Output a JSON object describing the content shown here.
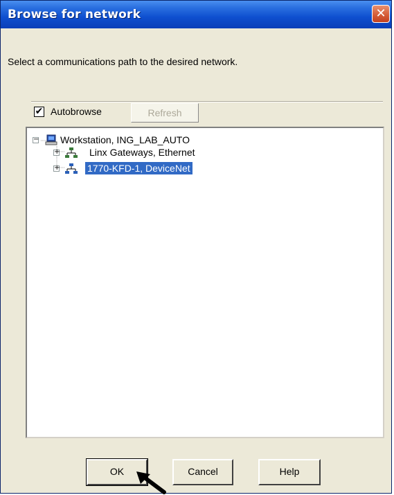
{
  "window": {
    "title": "Browse for network"
  },
  "instruction": "Select a communications path to the desired network.",
  "autobrowse": {
    "label": "Autobrowse",
    "checked": true,
    "check_glyph": "✔"
  },
  "refresh_button": {
    "label": "Refresh",
    "enabled": false
  },
  "tree": {
    "root": {
      "label": "Workstation, ING_LAB_AUTO",
      "icon": "workstation-icon",
      "expander": "−"
    },
    "children": [
      {
        "label": "Linx Gateways, Ethernet",
        "icon": "network-icon",
        "expander": "+"
      },
      {
        "label": "1770-KFD-1, DeviceNet",
        "icon": "network-icon",
        "expander": "+",
        "selected": true
      }
    ]
  },
  "buttons": {
    "ok": "OK",
    "cancel": "Cancel",
    "help": "Help"
  },
  "close_glyph": "✕",
  "colors": {
    "titlebar": "#0a3fb8",
    "selection": "#316ac5",
    "close": "#d45a35",
    "face": "#ece9d8"
  }
}
